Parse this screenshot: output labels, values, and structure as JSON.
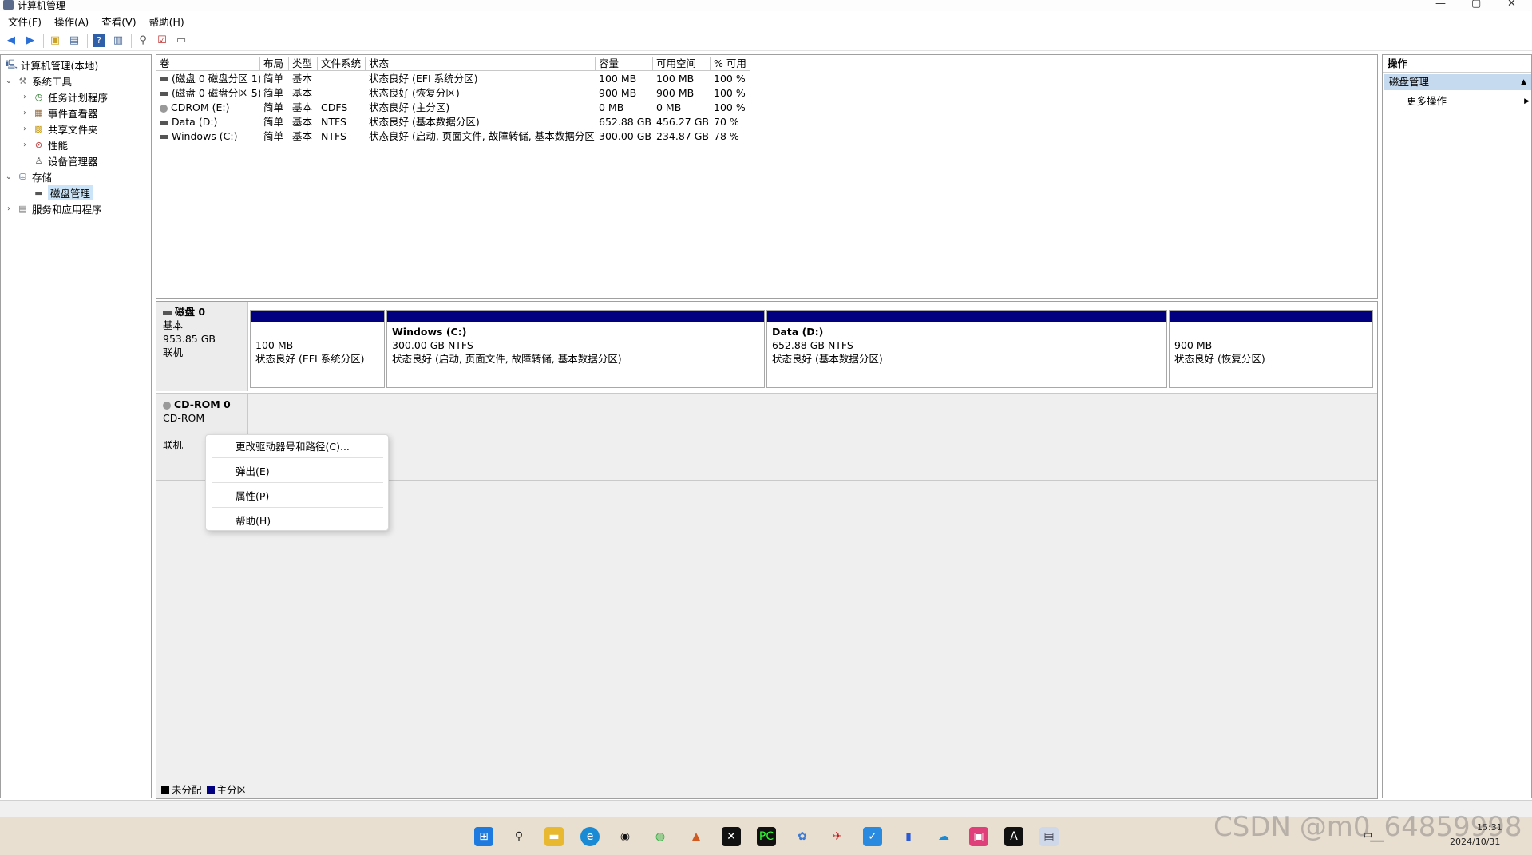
{
  "window": {
    "title": "计算机管理"
  },
  "menu": [
    "文件(F)",
    "操作(A)",
    "查看(V)",
    "帮助(H)"
  ],
  "tree": {
    "root": "计算机管理(本地)",
    "system_tools": "系统工具",
    "task_scheduler": "任务计划程序",
    "event_viewer": "事件查看器",
    "shared_folders": "共享文件夹",
    "performance": "性能",
    "device_manager": "设备管理器",
    "storage": "存储",
    "disk_management": "磁盘管理",
    "services_apps": "服务和应用程序"
  },
  "volumes": {
    "headers": [
      "卷",
      "布局",
      "类型",
      "文件系统",
      "状态",
      "容量",
      "可用空间",
      "% 可用"
    ],
    "rows": [
      [
        "(磁盘 0 磁盘分区 1)",
        "简单",
        "基本",
        "",
        "状态良好 (EFI 系统分区)",
        "100 MB",
        "100 MB",
        "100 %"
      ],
      [
        "(磁盘 0 磁盘分区 5)",
        "简单",
        "基本",
        "",
        "状态良好 (恢复分区)",
        "900 MB",
        "900 MB",
        "100 %"
      ],
      [
        "CDROM (E:)",
        "简单",
        "基本",
        "CDFS",
        "状态良好 (主分区)",
        "0 MB",
        "0 MB",
        "100 %"
      ],
      [
        "Data (D:)",
        "简单",
        "基本",
        "NTFS",
        "状态良好 (基本数据分区)",
        "652.88 GB",
        "456.27 GB",
        "70 %"
      ],
      [
        "Windows (C:)",
        "简单",
        "基本",
        "NTFS",
        "状态良好 (启动, 页面文件, 故障转储, 基本数据分区)",
        "300.00 GB",
        "234.87 GB",
        "78 %"
      ]
    ]
  },
  "disk0": {
    "name": "磁盘 0",
    "type": "基本",
    "size": "953.85 GB",
    "status": "联机",
    "parts": [
      {
        "title": "",
        "size": "100 MB",
        "state": "状态良好 (EFI 系统分区)"
      },
      {
        "title": "Windows  (C:)",
        "size": "300.00 GB NTFS",
        "state": "状态良好 (启动, 页面文件, 故障转储, 基本数据分区)"
      },
      {
        "title": "Data  (D:)",
        "size": "652.88 GB NTFS",
        "state": "状态良好 (基本数据分区)"
      },
      {
        "title": "",
        "size": "900 MB",
        "state": "状态良好 (恢复分区)"
      }
    ]
  },
  "cdrom0": {
    "name": "CD-ROM 0",
    "type": "CD-ROM",
    "status": "联机"
  },
  "context_menu": [
    "更改驱动器号和路径(C)...",
    "弹出(E)",
    "属性(P)",
    "帮助(H)"
  ],
  "legend": {
    "unallocated": "未分配",
    "primary": "主分区"
  },
  "actions": {
    "header": "操作",
    "selected": "磁盘管理",
    "more": "更多操作"
  },
  "tray": {
    "ime": "中",
    "time": "15:31",
    "date": "2024/10/31"
  },
  "watermark": "CSDN @m0_64859998",
  "colors": {
    "partition_bar": "#000080",
    "selection": "#cce4f7",
    "action_sel": "#c5d9ef"
  }
}
